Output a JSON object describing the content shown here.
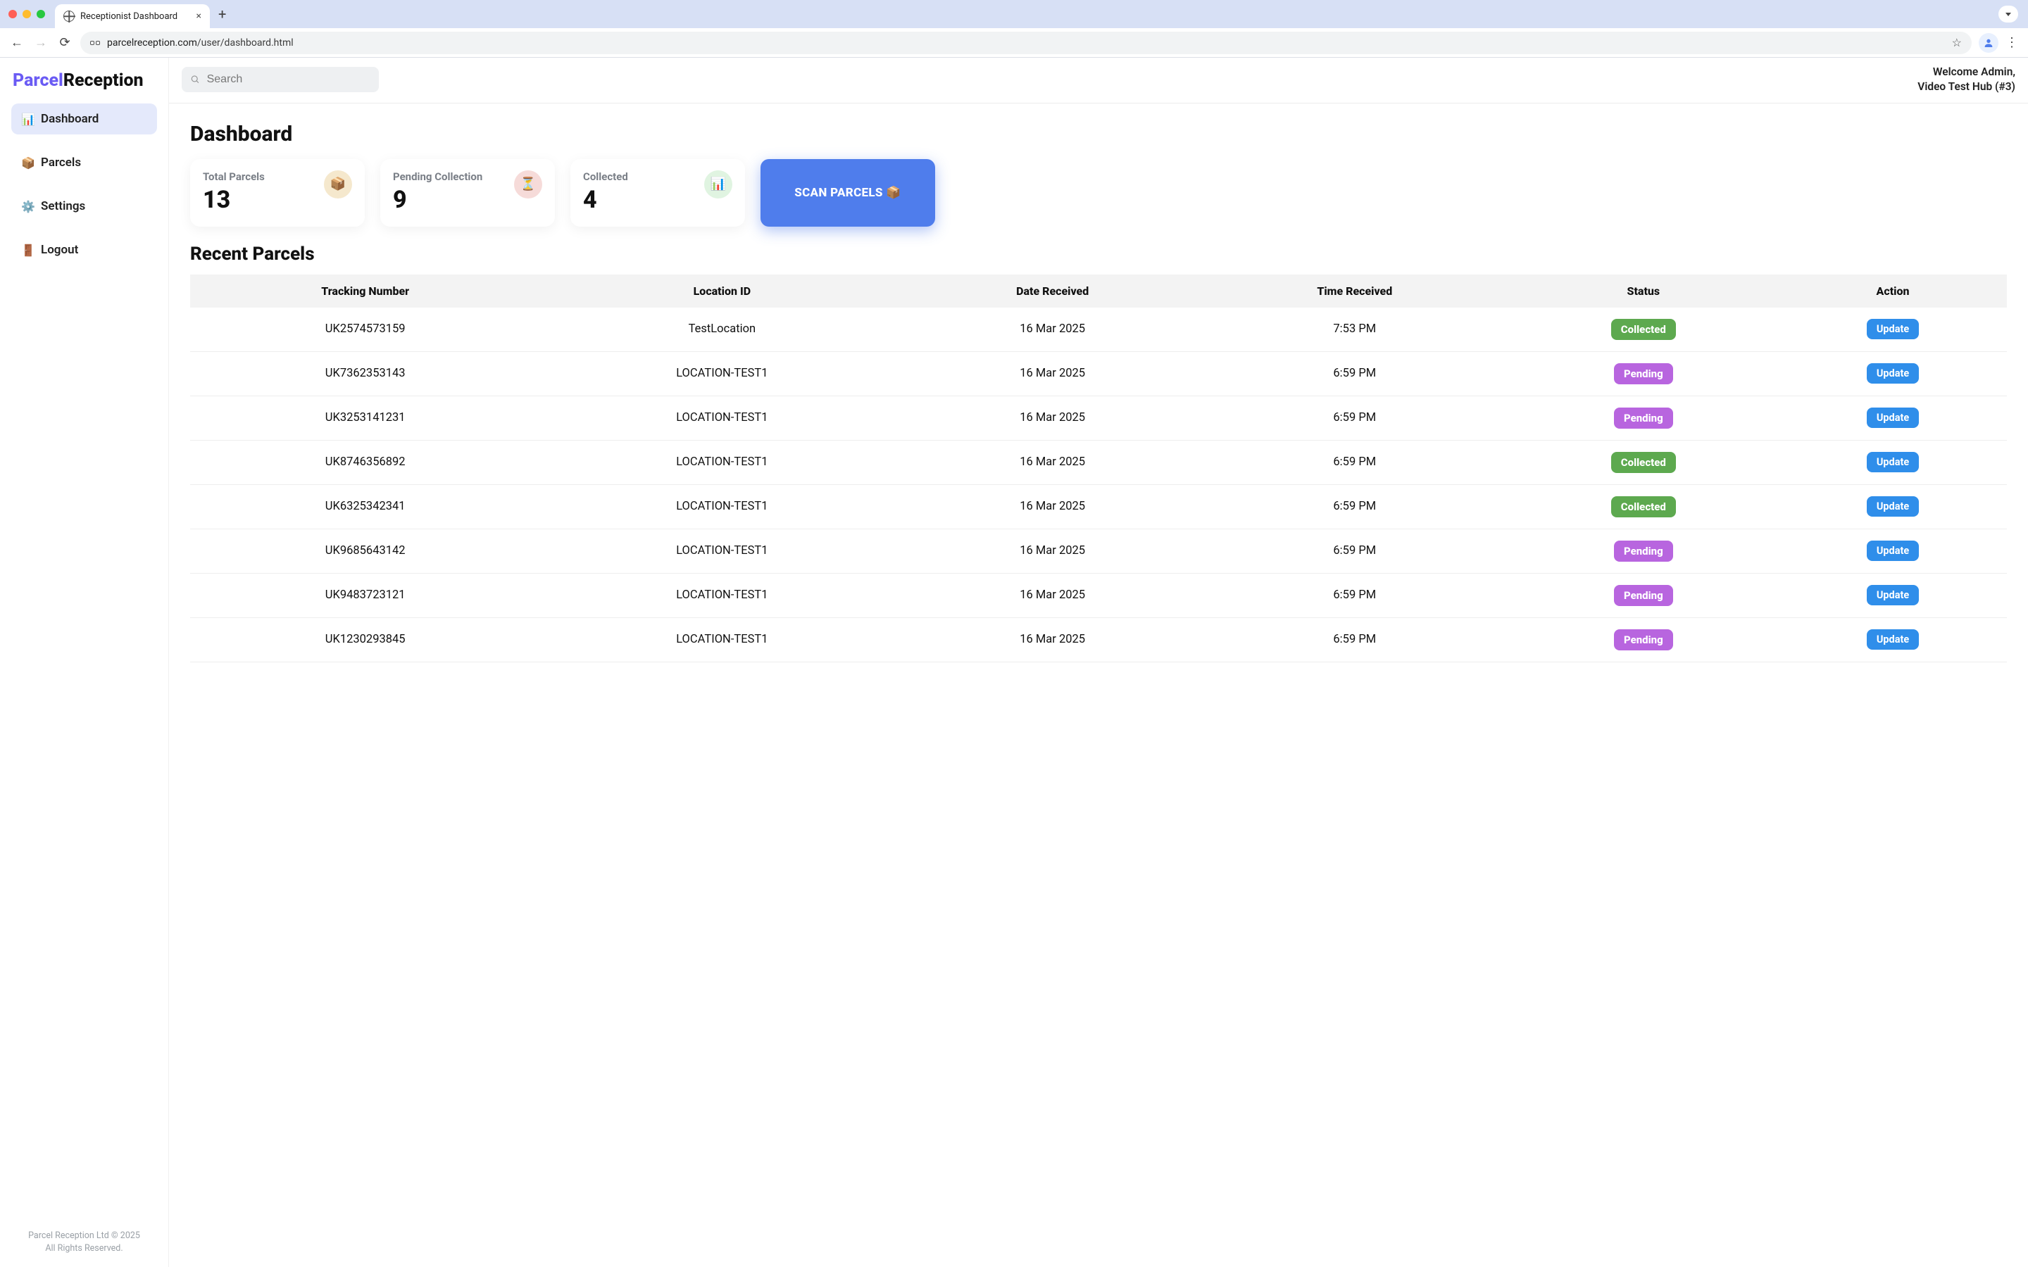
{
  "browser": {
    "tab_title": "Receptionist Dashboard",
    "url_host": "parcelreception.com",
    "url_path": "/user/dashboard.html"
  },
  "brand": {
    "part1": "Parcel",
    "part2": "Reception"
  },
  "sidebar": {
    "items": [
      {
        "icon": "📊",
        "label": "Dashboard",
        "active": true
      },
      {
        "icon": "📦",
        "label": "Parcels",
        "active": false
      },
      {
        "icon": "⚙️",
        "label": "Settings",
        "active": false
      },
      {
        "icon": "🚪",
        "label": "Logout",
        "active": false
      }
    ],
    "footer1": "Parcel Reception Ltd © 2025",
    "footer2": "All Rights Reserved."
  },
  "topbar": {
    "search_placeholder": "Search",
    "welcome_line1": "Welcome Admin,",
    "welcome_line2": "Video Test Hub (#3)"
  },
  "page": {
    "title": "Dashboard",
    "recent_title": "Recent Parcels",
    "scan_label": "SCAN PARCELS 📦"
  },
  "stats": [
    {
      "label": "Total Parcels",
      "value": "13",
      "icon": "📦",
      "iconClass": "ic-box"
    },
    {
      "label": "Pending Collection",
      "value": "9",
      "icon": "⏳",
      "iconClass": "ic-hour"
    },
    {
      "label": "Collected",
      "value": "4",
      "icon": "📊",
      "iconClass": "ic-chart"
    }
  ],
  "table": {
    "headers": [
      "Tracking Number",
      "Location ID",
      "Date Received",
      "Time Received",
      "Status",
      "Action"
    ],
    "action_label": "Update",
    "rows": [
      {
        "tracking": "UK2574573159",
        "location": "TestLocation",
        "date": "16 Mar 2025",
        "time": "7:53 PM",
        "status": "Collected"
      },
      {
        "tracking": "UK7362353143",
        "location": "LOCATION-TEST1",
        "date": "16 Mar 2025",
        "time": "6:59 PM",
        "status": "Pending"
      },
      {
        "tracking": "UK3253141231",
        "location": "LOCATION-TEST1",
        "date": "16 Mar 2025",
        "time": "6:59 PM",
        "status": "Pending"
      },
      {
        "tracking": "UK8746356892",
        "location": "LOCATION-TEST1",
        "date": "16 Mar 2025",
        "time": "6:59 PM",
        "status": "Collected"
      },
      {
        "tracking": "UK6325342341",
        "location": "LOCATION-TEST1",
        "date": "16 Mar 2025",
        "time": "6:59 PM",
        "status": "Collected"
      },
      {
        "tracking": "UK9685643142",
        "location": "LOCATION-TEST1",
        "date": "16 Mar 2025",
        "time": "6:59 PM",
        "status": "Pending"
      },
      {
        "tracking": "UK9483723121",
        "location": "LOCATION-TEST1",
        "date": "16 Mar 2025",
        "time": "6:59 PM",
        "status": "Pending"
      },
      {
        "tracking": "UK1230293845",
        "location": "LOCATION-TEST1",
        "date": "16 Mar 2025",
        "time": "6:59 PM",
        "status": "Pending"
      }
    ]
  }
}
